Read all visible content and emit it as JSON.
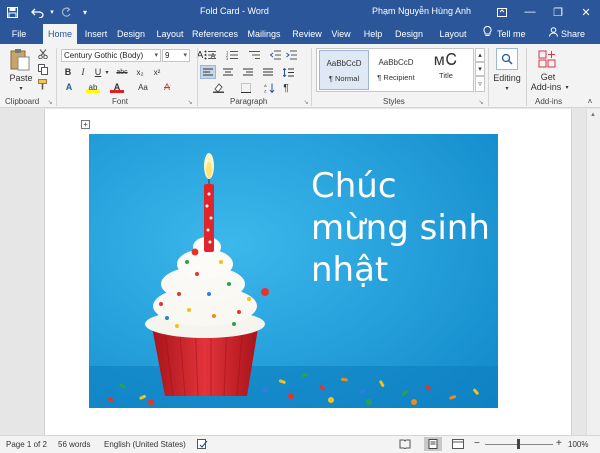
{
  "window": {
    "title": "Fold Card  -  Word",
    "user": "Phạm Nguyễn Hùng Anh",
    "minimize": "—",
    "restore": "❐",
    "close": "✕"
  },
  "tabs": [
    {
      "label": "File"
    },
    {
      "label": "Home"
    },
    {
      "label": "Insert"
    },
    {
      "label": "Design"
    },
    {
      "label": "Layout"
    },
    {
      "label": "References"
    },
    {
      "label": "Mailings"
    },
    {
      "label": "Review"
    },
    {
      "label": "View"
    },
    {
      "label": "Help"
    },
    {
      "label": "Design"
    },
    {
      "label": "Layout"
    }
  ],
  "tell_me": "Tell me",
  "share": "Share",
  "ribbon": {
    "clipboard": {
      "paste": "Paste",
      "label": "Clipboard"
    },
    "font": {
      "family": "Century Gothic (Body)",
      "size": "9",
      "label": "Font",
      "bold": "B",
      "italic": "I",
      "underline": "U",
      "strike": "abc",
      "sub": "x₂",
      "sup": "x²",
      "grow": "A",
      "shrink": "A",
      "case": "Aa",
      "clear": "A",
      "effects": "A",
      "highlight": "ab",
      "color": "A"
    },
    "paragraph": {
      "label": "Paragraph"
    },
    "styles": {
      "label": "Styles",
      "items": [
        {
          "sample": "AaBbCcD",
          "name": "¶ Normal"
        },
        {
          "sample": "AaBbCcD",
          "name": "¶ Recipient"
        },
        {
          "sample": "ᴍᏟ",
          "name": "Title"
        }
      ]
    },
    "editing": {
      "label": "Editing"
    },
    "addins": {
      "get": "Get",
      "get2": "Add-ins",
      "label": "Add-ins"
    }
  },
  "card": {
    "line1": "Chúc",
    "line2": "mừng sinh",
    "line3": "nhật"
  },
  "status": {
    "page": "Page 1 of 2",
    "words": "56 words",
    "language": "English (United States)",
    "zoom": "100%"
  },
  "colors": {
    "brand": "#2b579a",
    "card_bg": "#1ea0dc",
    "cup": "#d4222a"
  }
}
